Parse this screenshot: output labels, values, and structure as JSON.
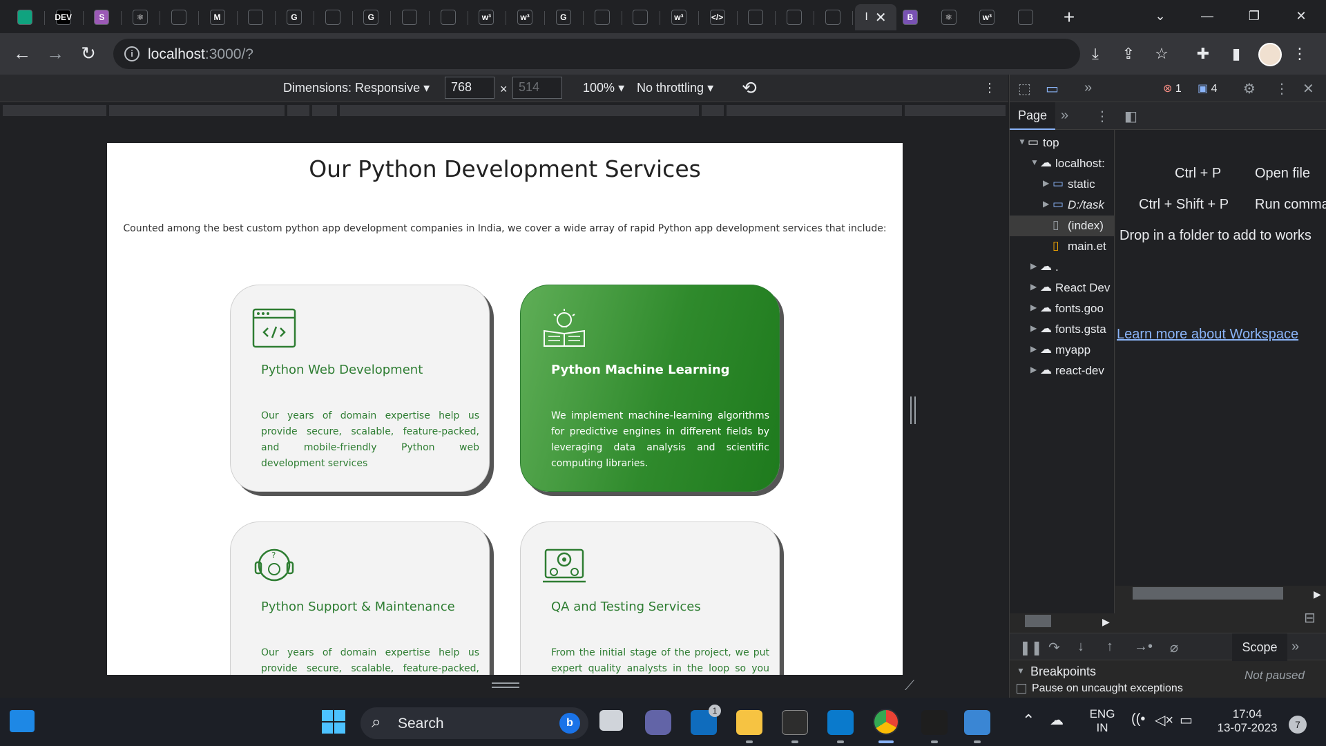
{
  "browser": {
    "tabs": [
      {
        "icon": "chatgpt-icon",
        "label": "",
        "color": "#10a37f"
      },
      {
        "icon": "dev-icon",
        "label": "DEV",
        "color": "#000000"
      },
      {
        "icon": "sites-icon",
        "label": "S",
        "color": "#9b59b6"
      },
      {
        "icon": "react-icon",
        "label": "⚛",
        "color": "#202124"
      },
      {
        "icon": "github-icon",
        "label": "",
        "color": "#202124"
      },
      {
        "icon": "gmail-icon",
        "label": "M",
        "color": "#202124"
      },
      {
        "icon": "figma-icon",
        "label": "",
        "color": "#202124"
      },
      {
        "icon": "google-icon",
        "label": "G",
        "color": "#202124"
      },
      {
        "icon": "globe-icon",
        "label": "",
        "color": "#202124"
      },
      {
        "icon": "google-icon",
        "label": "G",
        "color": "#202124"
      },
      {
        "icon": "drive-icon",
        "label": "",
        "color": "#202124"
      },
      {
        "icon": "github-icon",
        "label": "",
        "color": "#202124"
      },
      {
        "icon": "w3schools-icon",
        "label": "w³",
        "color": "#202124"
      },
      {
        "icon": "w3schools-icon",
        "label": "w³",
        "color": "#202124"
      },
      {
        "icon": "google-icon",
        "label": "G",
        "color": "#202124"
      },
      {
        "icon": "globe-icon",
        "label": "",
        "color": "#202124"
      },
      {
        "icon": "globe-icon",
        "label": "",
        "color": "#202124"
      },
      {
        "icon": "w3schools-icon",
        "label": "w³",
        "color": "#202124"
      },
      {
        "icon": "code-icon",
        "label": "</>",
        "color": "#202124"
      },
      {
        "icon": "scribe-icon",
        "label": "",
        "color": "#202124"
      },
      {
        "icon": "github-icon",
        "label": "",
        "color": "#202124"
      },
      {
        "icon": "stackoverflow-icon",
        "label": "",
        "color": "#202124"
      }
    ],
    "active_tab_label": "I",
    "after_tabs": [
      {
        "icon": "bootstrap-icon",
        "label": "B",
        "color": "#7952b3"
      },
      {
        "icon": "react-icon",
        "label": "⚛",
        "color": "#202124"
      },
      {
        "icon": "w3schools-icon",
        "label": "w³",
        "color": "#202124"
      },
      {
        "icon": "zoho-icon",
        "label": "",
        "color": "#202124"
      }
    ],
    "url_host": "localhost",
    "url_path": ":3000/?"
  },
  "device_toolbar": {
    "dimensions_label": "Dimensions: Responsive",
    "width": "768",
    "height": "514",
    "zoom": "100%",
    "throttling": "No throttling"
  },
  "page": {
    "title": "Our Python Development Services",
    "description": "Counted among the best custom python app development companies in India, we cover a wide array of rapid Python app development services that include:",
    "cards": [
      {
        "title": "Python Web Development",
        "desc": "Our years of domain expertise help us provide secure, scalable, feature-packed, and mobile-friendly Python web development services",
        "icon": "code-window-icon"
      },
      {
        "title": "Python Machine Learning",
        "desc": "We implement machine-learning algorithms for predictive engines in different fields by leveraging data analysis and scientific computing libraries.",
        "icon": "lightbulb-book-icon"
      },
      {
        "title": "Python Support & Maintenance",
        "desc": "Our years of domain expertise help us provide secure, scalable, feature-packed, and mobile-friendly Python web development services",
        "icon": "support-headset-icon"
      },
      {
        "title": "QA and Testing Services",
        "desc": "From the initial stage of the project, we put expert quality analysts in the loop so you can",
        "icon": "gear-laptop-icon"
      }
    ],
    "accent": "#2e7d32"
  },
  "devtools": {
    "errors": "1",
    "messages": "4",
    "page_tab": "Page",
    "tree": [
      {
        "label": "top",
        "icon": "frame-icon",
        "depth": 0,
        "expanded": true
      },
      {
        "label": "localhost:",
        "icon": "cloud-icon",
        "depth": 1,
        "expanded": true
      },
      {
        "label": "static",
        "icon": "folder-icon",
        "depth": 2,
        "expanded": false
      },
      {
        "label": "D:/task",
        "icon": "folder-icon",
        "depth": 2,
        "expanded": false
      },
      {
        "label": "(index)",
        "icon": "file-icon",
        "depth": 2,
        "expanded": null
      },
      {
        "label": "main.et",
        "icon": "js-file-icon",
        "depth": 2,
        "expanded": null
      },
      {
        "label": ".",
        "icon": "cloud-icon",
        "depth": 1,
        "expanded": false
      },
      {
        "label": "React Dev",
        "icon": "cloud-icon",
        "depth": 1,
        "expanded": false
      },
      {
        "label": "fonts.goo",
        "icon": "cloud-icon",
        "depth": 1,
        "expanded": false
      },
      {
        "label": "fonts.gsta",
        "icon": "cloud-icon",
        "depth": 1,
        "expanded": false
      },
      {
        "label": "myapp",
        "icon": "cloud-icon",
        "depth": 1,
        "expanded": false
      },
      {
        "label": "react-dev",
        "icon": "cloud-icon",
        "depth": 1,
        "expanded": false
      }
    ],
    "shortcuts": [
      {
        "keys": "Ctrl + P",
        "action": "Open file"
      },
      {
        "keys": "Ctrl + Shift + P",
        "action": "Run comma"
      }
    ],
    "drop_hint": "Drop in a folder to add to works",
    "learn_link": "Learn more about Workspace",
    "scope_tab": "Scope",
    "breakpoints": "Breakpoints",
    "not_paused": "Not paused",
    "pause_option": "Pause on uncaught exceptions"
  },
  "taskbar": {
    "search_label": "Search",
    "mail_badge": "1",
    "lang_top": "ENG",
    "lang_bottom": "IN",
    "time": "17:04",
    "date": "13-07-2023",
    "notif_count": "7"
  }
}
